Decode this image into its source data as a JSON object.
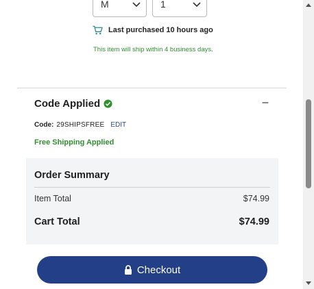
{
  "product_options": {
    "size_value": "M",
    "quantity_value": "1"
  },
  "last_purchased": "Last purchased 10 hours ago",
  "ship_note": "This item will ship within 4 business days.",
  "promo": {
    "title": "Code Applied",
    "collapse_symbol": "–",
    "code_label": "Code:",
    "code_value": "29SHIPSFREE",
    "edit_label": "EDIT",
    "shipping_status": "Free Shipping Applied"
  },
  "order_summary": {
    "heading": "Order Summary",
    "item_total_label": "Item Total",
    "item_total_value": "$74.99",
    "cart_total_label": "Cart Total",
    "cart_total_value": "$74.99"
  },
  "checkout": {
    "label": "Checkout"
  },
  "icons": {
    "cart": "cart-icon",
    "check": "check-circle-icon",
    "lock": "lock-icon",
    "chevron": "chevron-down-icon"
  },
  "colors": {
    "checkout_button": "#233f87",
    "success_green": "#2f8f2f",
    "edit_link": "#2d4b8a",
    "cart_icon": "#2a8c93",
    "summary_background": "#f3f4f6"
  }
}
